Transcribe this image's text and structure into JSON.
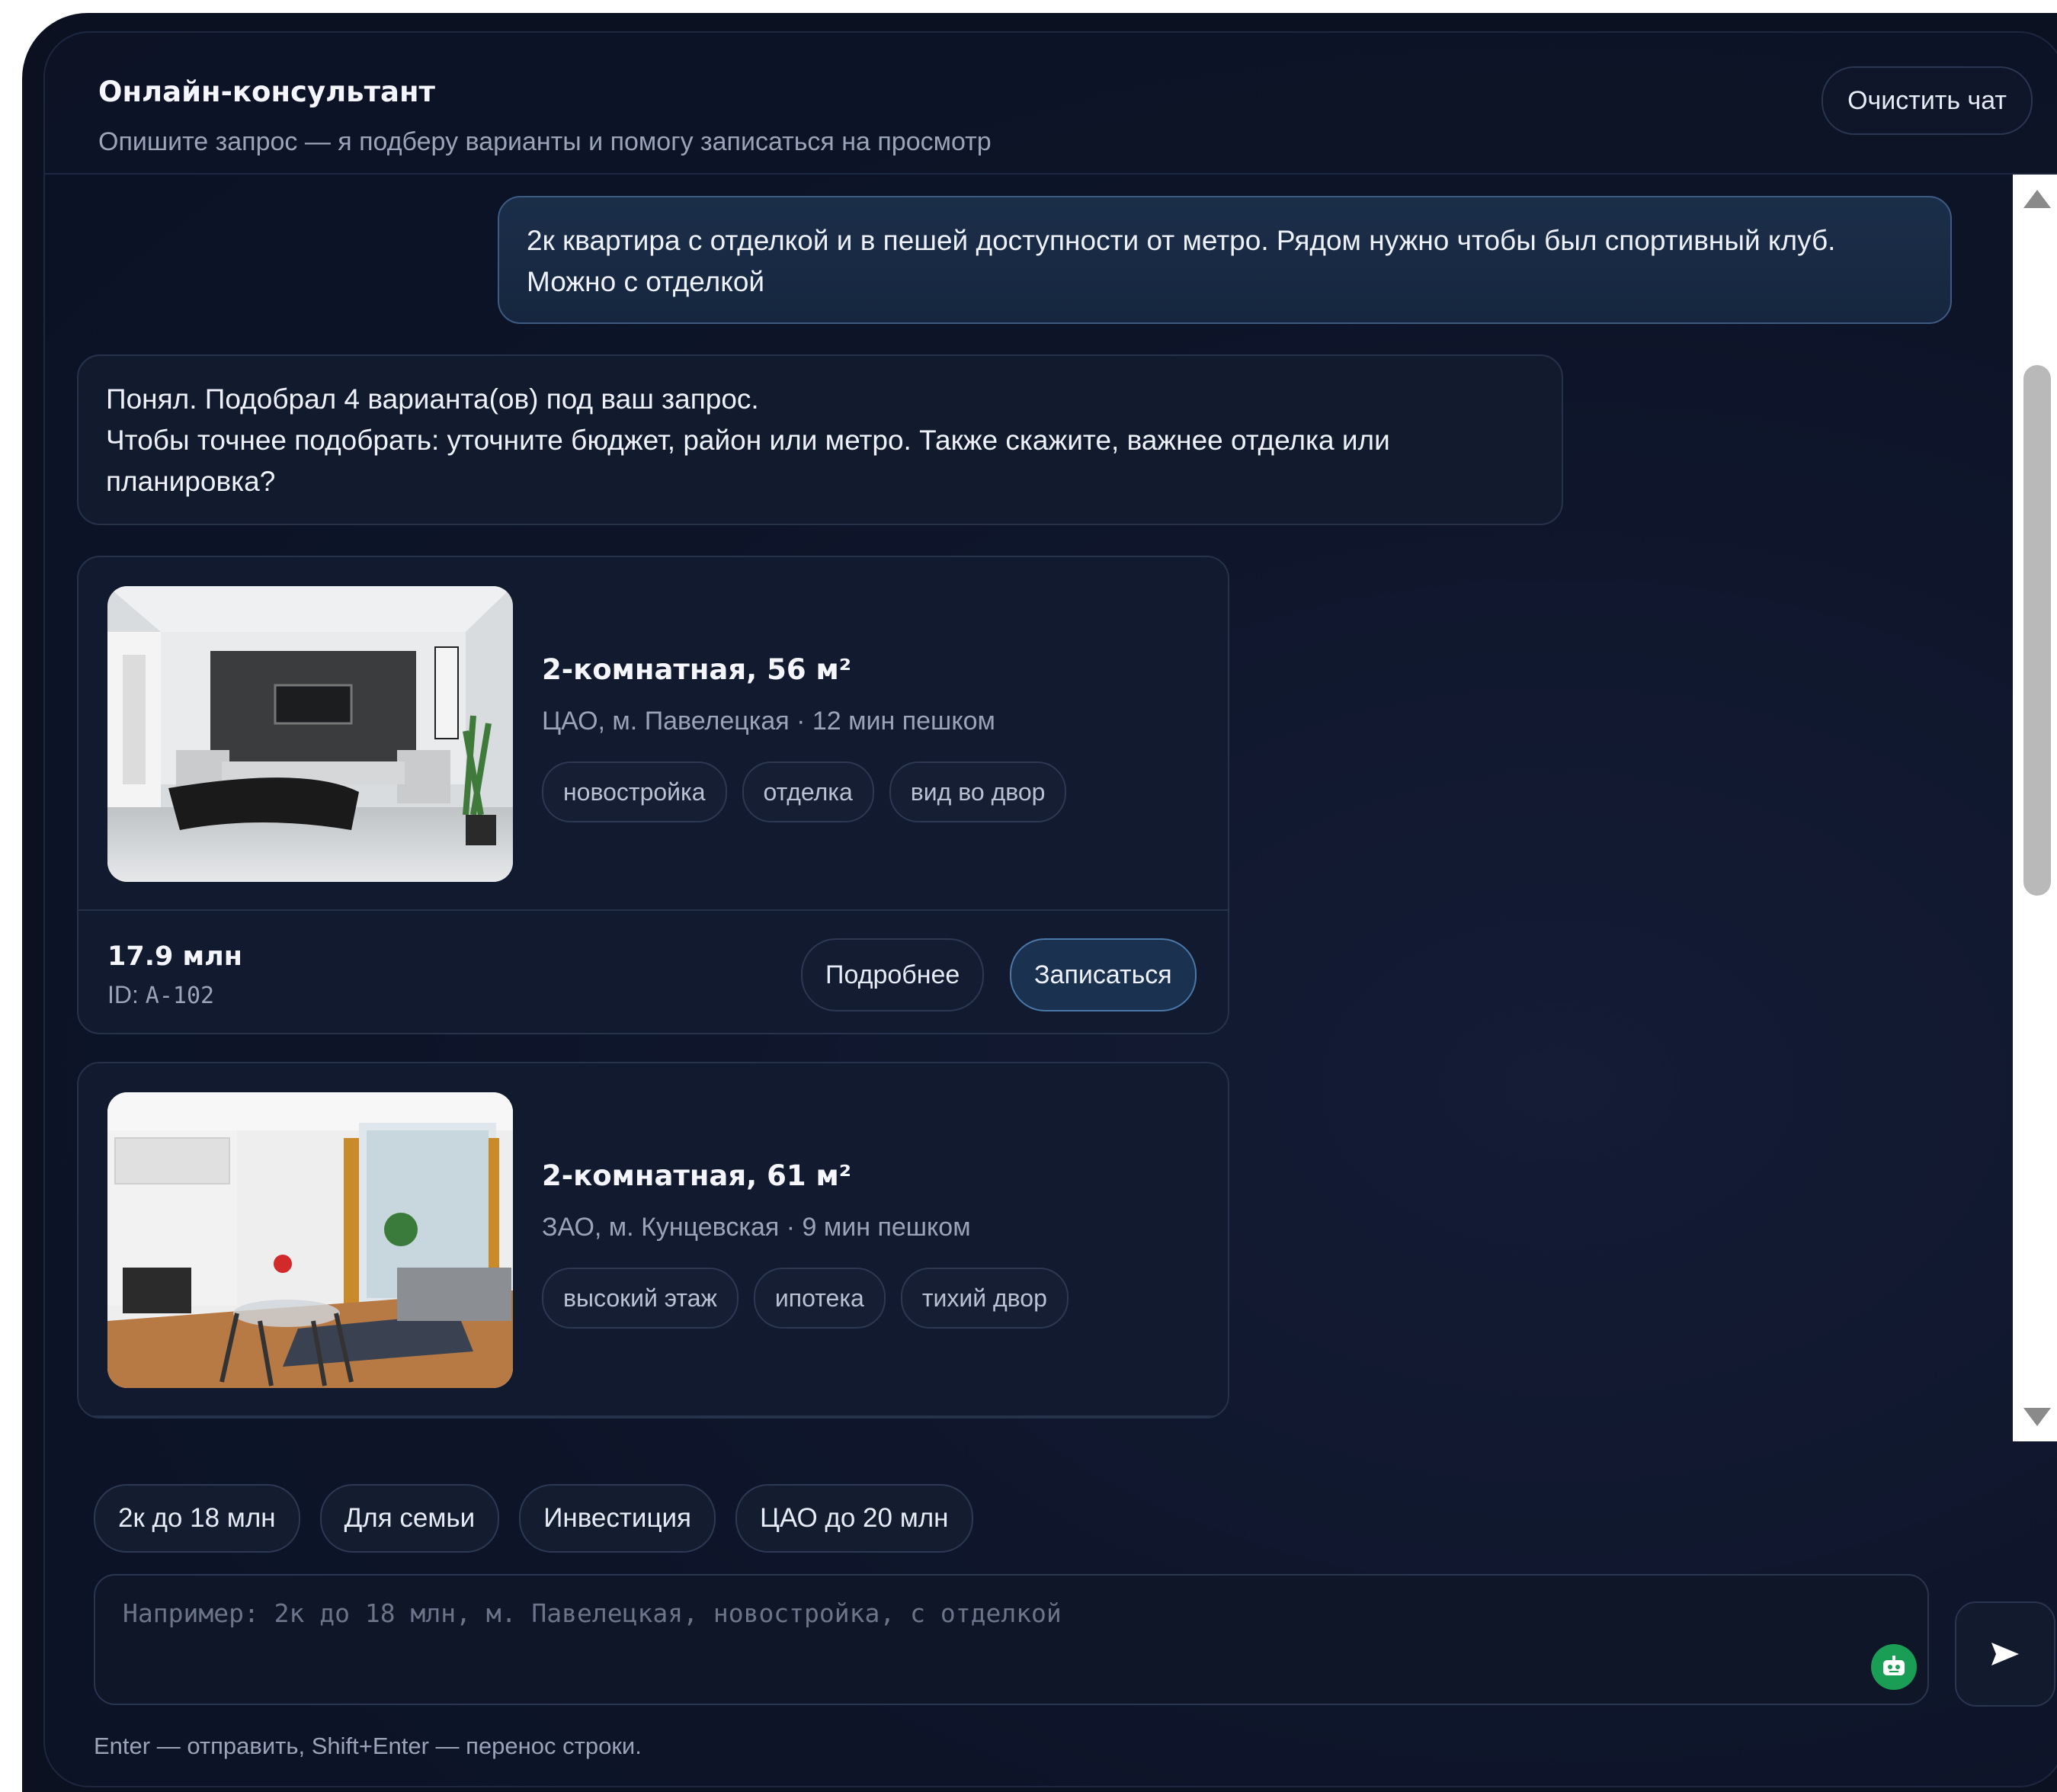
{
  "header": {
    "title": "Онлайн-консультант",
    "subtitle": "Опишите запрос — я подберу варианты и помогу записаться на просмотр",
    "clear_label": "Очистить чат"
  },
  "messages": {
    "user": {
      "line1": "2к квартира с отделкой и в пешей доступности от метро. Рядом нужно чтобы был спортивный клуб.",
      "line2": "Можно с отделкой"
    },
    "bot": {
      "line1": "Понял. Подобрал 4 варианта(ов) под ваш запрос.",
      "line2": "Чтобы точнее подобрать: уточните бюджет, район или метро. Также скажите, важнее отделка или",
      "line3": "планировка?"
    }
  },
  "listings": [
    {
      "title": "2-комнатная, 56 м²",
      "location": "ЦАО, м. Павелецкая · 12 мин пешком",
      "tags": [
        "новостройка",
        "отделка",
        "вид во двор"
      ],
      "price": "17.9 млн",
      "id_label": "ID:",
      "id": "A-102",
      "more_label": "Подробнее",
      "book_label": "Записаться"
    },
    {
      "title": "2-комнатная, 61 м²",
      "location": "ЗАО, м. Кунцевская · 9 мин пешком",
      "tags": [
        "высокий этаж",
        "ипотека",
        "тихий двор"
      ]
    }
  ],
  "quick_chips": [
    "2к до 18 млн",
    "Для семьи",
    "Инвестиция",
    "ЦАО до 20 млн"
  ],
  "composer": {
    "placeholder": "Например: 2к до 18 млн, м. Павелецкая, новостройка, с отделкой",
    "value": "",
    "hint": "Enter — отправить, Shift+Enter — перенос строки."
  },
  "icons": {
    "send": "send-icon",
    "bot": "robot-icon",
    "scroll_up": "chevron-up-icon",
    "scroll_down": "chevron-down-icon"
  },
  "colors": {
    "background": "#0b1120",
    "accent_border": "#3d5a80",
    "bot_badge": "#1a9e55"
  }
}
